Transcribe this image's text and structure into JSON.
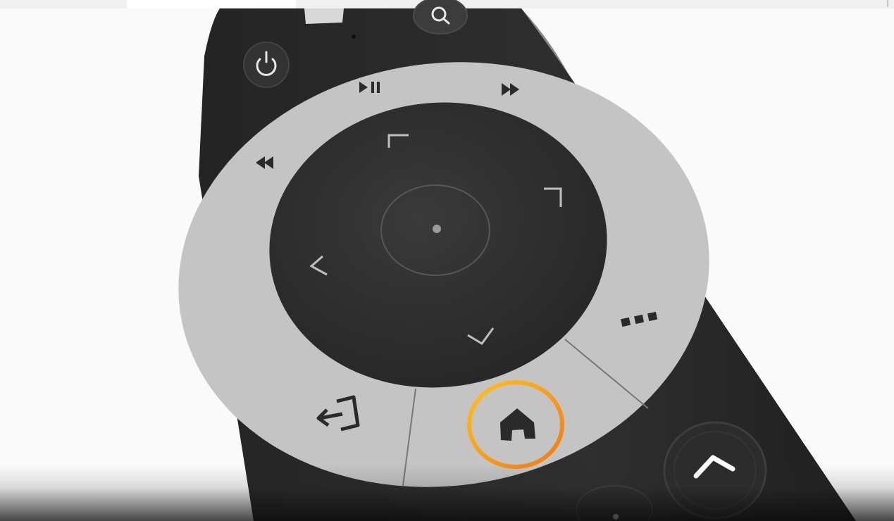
{
  "image": {
    "subject": "tv-remote-control",
    "colors": {
      "body": "#2b2b2b",
      "ring": "#c4c4c4",
      "dpad": "#323232",
      "highlight": "#f5a623",
      "background": "#fafafa"
    }
  },
  "buttons": {
    "power": "power-icon",
    "search": "search-icon",
    "play_pause": "play-pause-icon",
    "fast_forward": "fast-forward-icon",
    "rewind": "rewind-icon",
    "dpad_up": "chevron-up-icon",
    "dpad_right": "chevron-right-icon",
    "dpad_left": "chevron-left-icon",
    "dpad_down": "chevron-down-icon",
    "ok": "ok-dot-icon",
    "more": "ellipsis-icon",
    "back": "back-exit-icon",
    "home": "home-icon",
    "channel_up": "chevron-up-icon"
  }
}
